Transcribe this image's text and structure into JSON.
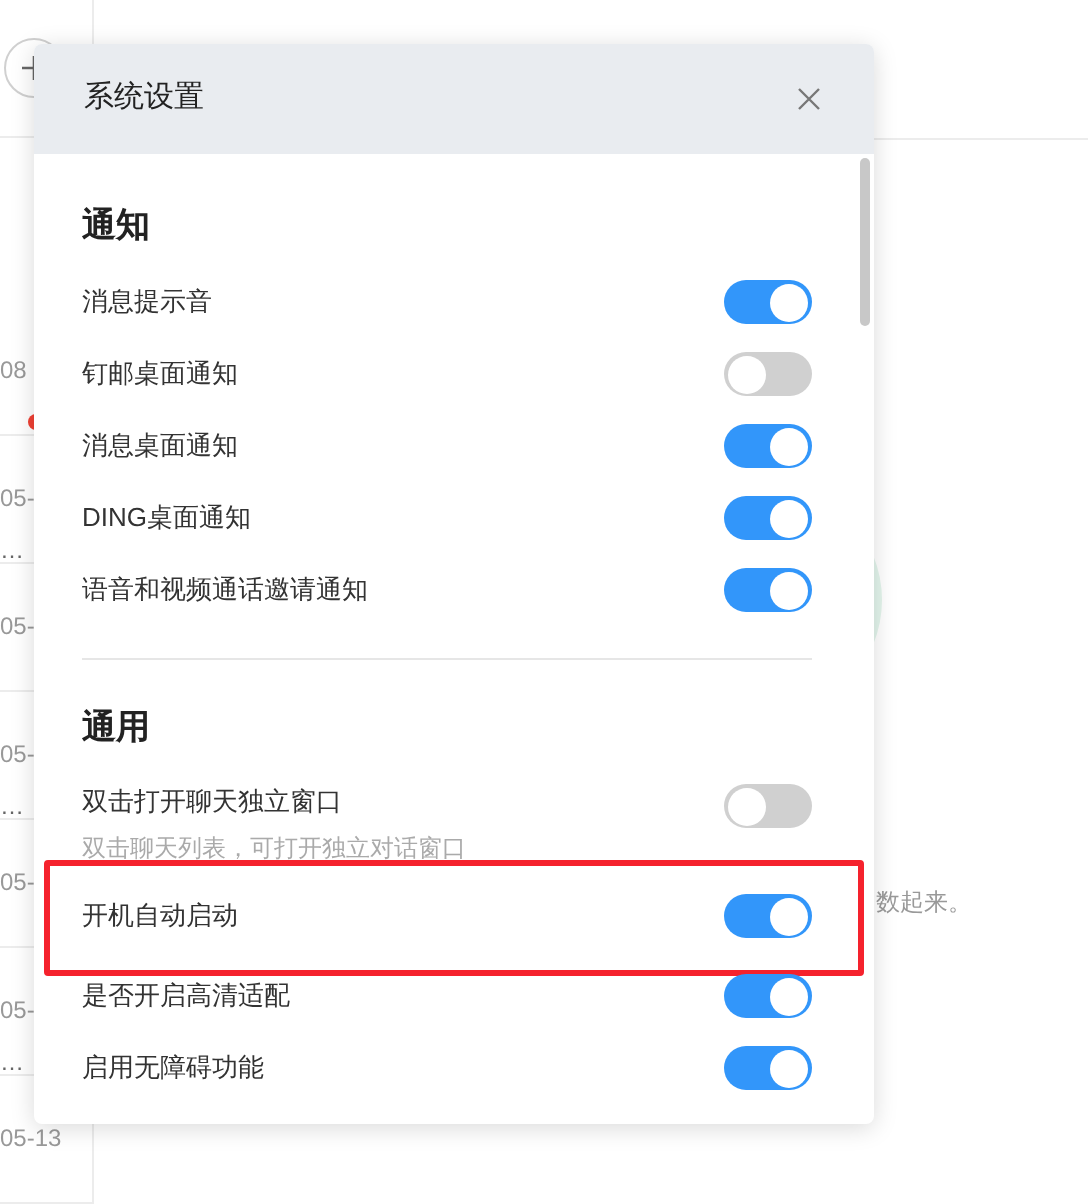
{
  "background": {
    "list_items": [
      {
        "date": "08",
        "unread": true
      },
      {
        "date": "05-",
        "preview": "…",
        "unread": false
      },
      {
        "date": "05-",
        "unread": false
      },
      {
        "date": "05-",
        "preview": "…",
        "unread": false
      },
      {
        "date": "05-",
        "unread": false
      },
      {
        "date": "05-",
        "preview": "…",
        "unread": false
      },
      {
        "date": "05-13",
        "unread": false
      }
    ],
    "hint": "数起来。"
  },
  "dialog": {
    "title": "系统设置",
    "sections": [
      {
        "title": "通知",
        "items": [
          {
            "label": "消息提示音",
            "on": true,
            "highlighted": false
          },
          {
            "label": "钉邮桌面通知",
            "on": false,
            "highlighted": false
          },
          {
            "label": "消息桌面通知",
            "on": true,
            "highlighted": false
          },
          {
            "label": "DING桌面通知",
            "on": true,
            "highlighted": false
          },
          {
            "label": "语音和视频通话邀请通知",
            "on": true,
            "highlighted": false
          }
        ]
      },
      {
        "title": "通用",
        "items": [
          {
            "label": "双击打开聊天独立窗口",
            "description": "双击聊天列表，可打开独立对话窗口",
            "on": false,
            "highlighted": false
          },
          {
            "label": "开机自动启动",
            "on": true,
            "highlighted": true
          },
          {
            "label": "是否开启高清适配",
            "on": true,
            "highlighted": false
          },
          {
            "label": "启用无障碍功能",
            "on": true,
            "highlighted": false
          }
        ]
      }
    ]
  }
}
